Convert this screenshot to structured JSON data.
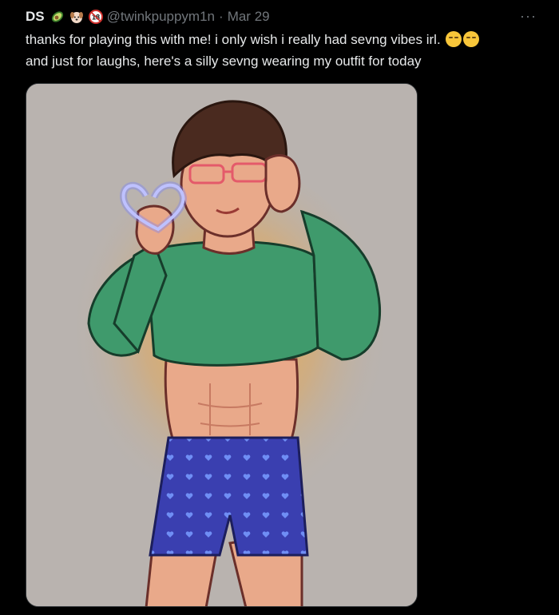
{
  "tweet": {
    "author_name": "DS",
    "badges": [
      "avocado-emoji",
      "puppy-emoji",
      "18-plus-emoji"
    ],
    "badge_18_text": "18",
    "handle": "@twinkpuppym1n",
    "separator": "·",
    "date": "Mar 29",
    "more_label": "···",
    "text_line_1": "thanks for playing this with me! i only wish i really had sevng vibes irl.",
    "text_line_2": "and just for laughs, here's a silly sevng wearing my outfit for today",
    "emojis": [
      "relieved-face-emoji",
      "grinning-squinting-face-emoji"
    ]
  },
  "media": {
    "description_icon": "illustration-image",
    "colors": {
      "background": "#b9b3af",
      "sweater": "#3f9a6c",
      "shorts": "#3a3fb0",
      "skin": "#e9a98a",
      "hair": "#4a2a1f"
    }
  }
}
